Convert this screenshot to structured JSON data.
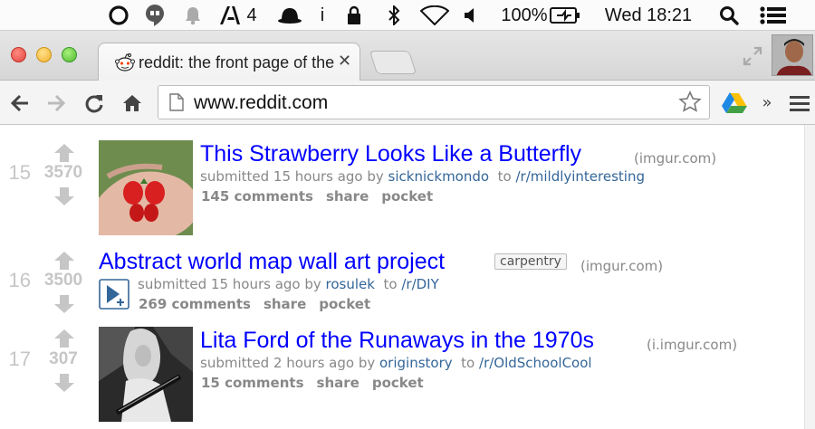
{
  "menubar": {
    "badge_count": "4",
    "info_glyph": "i",
    "battery_text": "100%",
    "clock": "Wed 18:21",
    "icons": [
      "circle-app-icon",
      "hangouts-icon",
      "bell-icon",
      "adobe-icon",
      "bowler-hat-icon",
      "lock-icon",
      "bluetooth-icon",
      "wifi-icon",
      "volume-icon",
      "battery-charging-icon",
      "spotlight-search-icon",
      "notification-center-icon"
    ]
  },
  "browser": {
    "tab_title": "reddit: the front page of the internet",
    "tab_close": "✕",
    "url": "www.reddit.com"
  },
  "posts": [
    {
      "rank": "15",
      "score": "3570",
      "title": "This Strawberry Looks Like a Butterfly",
      "domain": "(imgur.com)",
      "submitted": "submitted 15 hours ago by",
      "author": "sicknickmondo",
      "to": "to",
      "subreddit": "/r/mildlyinteresting",
      "comments": "145 comments",
      "share": "share",
      "pocket": "pocket",
      "thumbnail": "strawberry-butterfly-photo"
    },
    {
      "rank": "16",
      "score": "3500",
      "title": "Abstract world map wall art project",
      "flair": "carpentry",
      "domain": "(imgur.com)",
      "submitted": "submitted 15 hours ago by",
      "author": "rosulek",
      "to": "to",
      "subreddit": "/r/DIY",
      "comments": "269 comments",
      "share": "share",
      "pocket": "pocket",
      "thumbnail": "expando-play-icon"
    },
    {
      "rank": "17",
      "score": "307",
      "title": "Lita Ford of the Runaways in the 1970s",
      "domain": "(i.imgur.com)",
      "submitted": "submitted 2 hours ago by",
      "author": "originstory",
      "to": "to",
      "subreddit": "/r/OldSchoolCool",
      "comments": "15 comments",
      "share": "share",
      "pocket": "pocket",
      "thumbnail": "guitarist-bw-photo"
    }
  ],
  "colors": {
    "link": "#0000ff",
    "tagline_link": "#336699",
    "muted": "#888888",
    "score": "#c6c6c6"
  }
}
